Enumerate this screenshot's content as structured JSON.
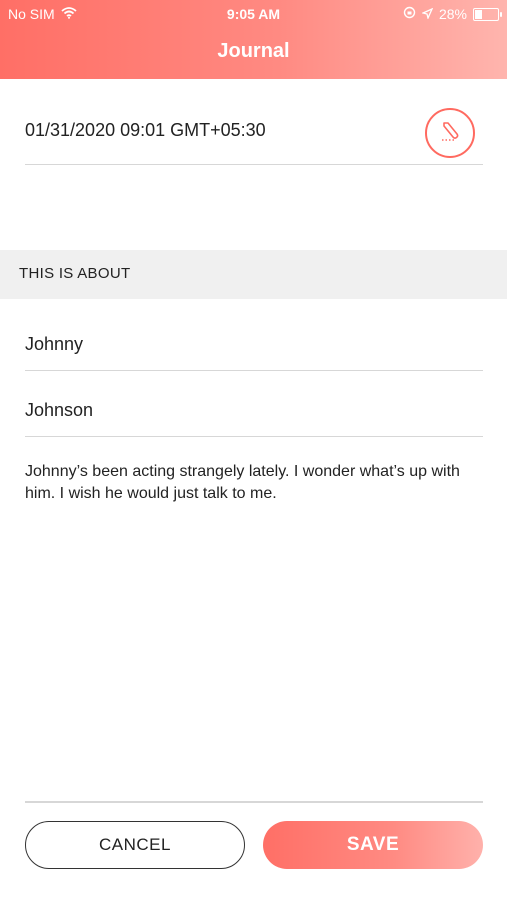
{
  "status_bar": {
    "carrier": "No SIM",
    "time": "9:05 AM",
    "battery_percent_text": "28%",
    "battery_level": 0.28,
    "icons": [
      "wifi-icon",
      "lock-rotation-icon",
      "location-icon",
      "battery-icon"
    ]
  },
  "header": {
    "title": "Journal"
  },
  "entry": {
    "datetime": "01/31/2020 09:01 GMT+05:30",
    "edit_icon": "pen-icon"
  },
  "about_section": {
    "title": "THIS IS ABOUT",
    "first_name": "Johnny",
    "last_name": "Johnson"
  },
  "note": {
    "text": "Johnny’s been acting strangely lately. I wonder what’s up with him. I wish he would just talk to me."
  },
  "actions": {
    "cancel_label": "CANCEL",
    "save_label": "SAVE"
  },
  "colors": {
    "accent": "#ff6a60",
    "header_gradient_start": "#ff6f66",
    "header_gradient_end": "#ffb5ae",
    "section_bg": "#f0f0f0",
    "divider": "#d7d7d7"
  }
}
